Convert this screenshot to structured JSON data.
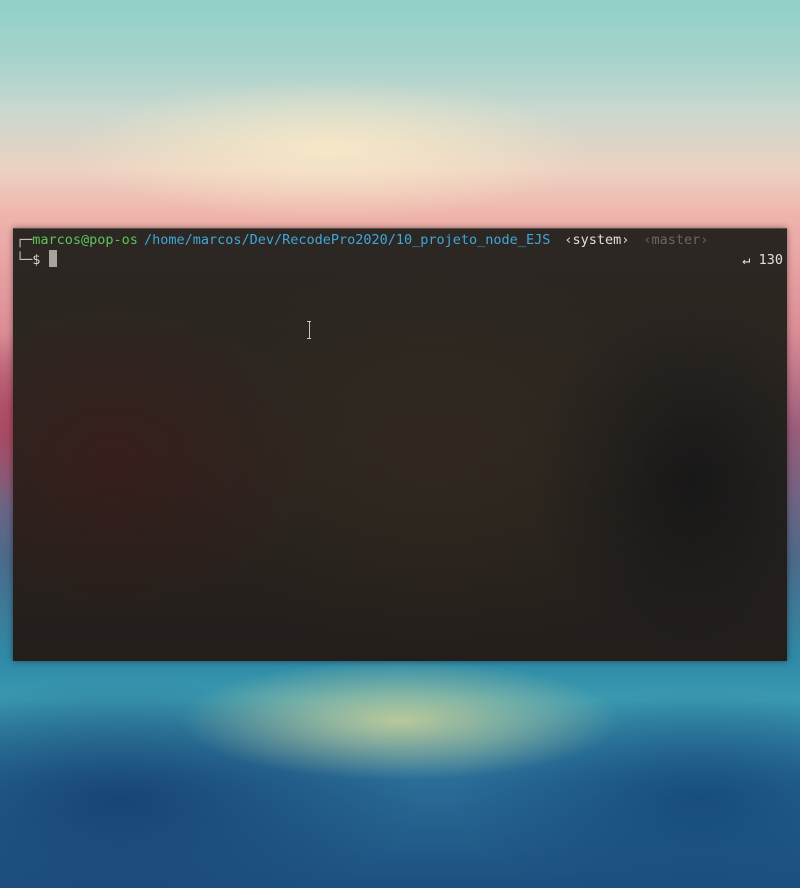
{
  "terminal": {
    "prompt": {
      "box_top": "┌─",
      "user_host": "marcos@pop-os",
      "cwd": "/home/marcos/Dev/RecodePro2020/10_projeto_node_EJS",
      "env": "‹system›",
      "git_branch": "‹master›",
      "box_bottom": "└─",
      "symbol": "$"
    },
    "exit_status": "↵ 130"
  },
  "colors": {
    "user_host": "#5cc45a",
    "cwd": "#3fa7d9",
    "branch": "#6c6560",
    "terminal_bg": "#2b2520"
  },
  "icons": {
    "mouse_pointer": "text-cursor-ibeam-icon",
    "return": "return-arrow-icon"
  }
}
